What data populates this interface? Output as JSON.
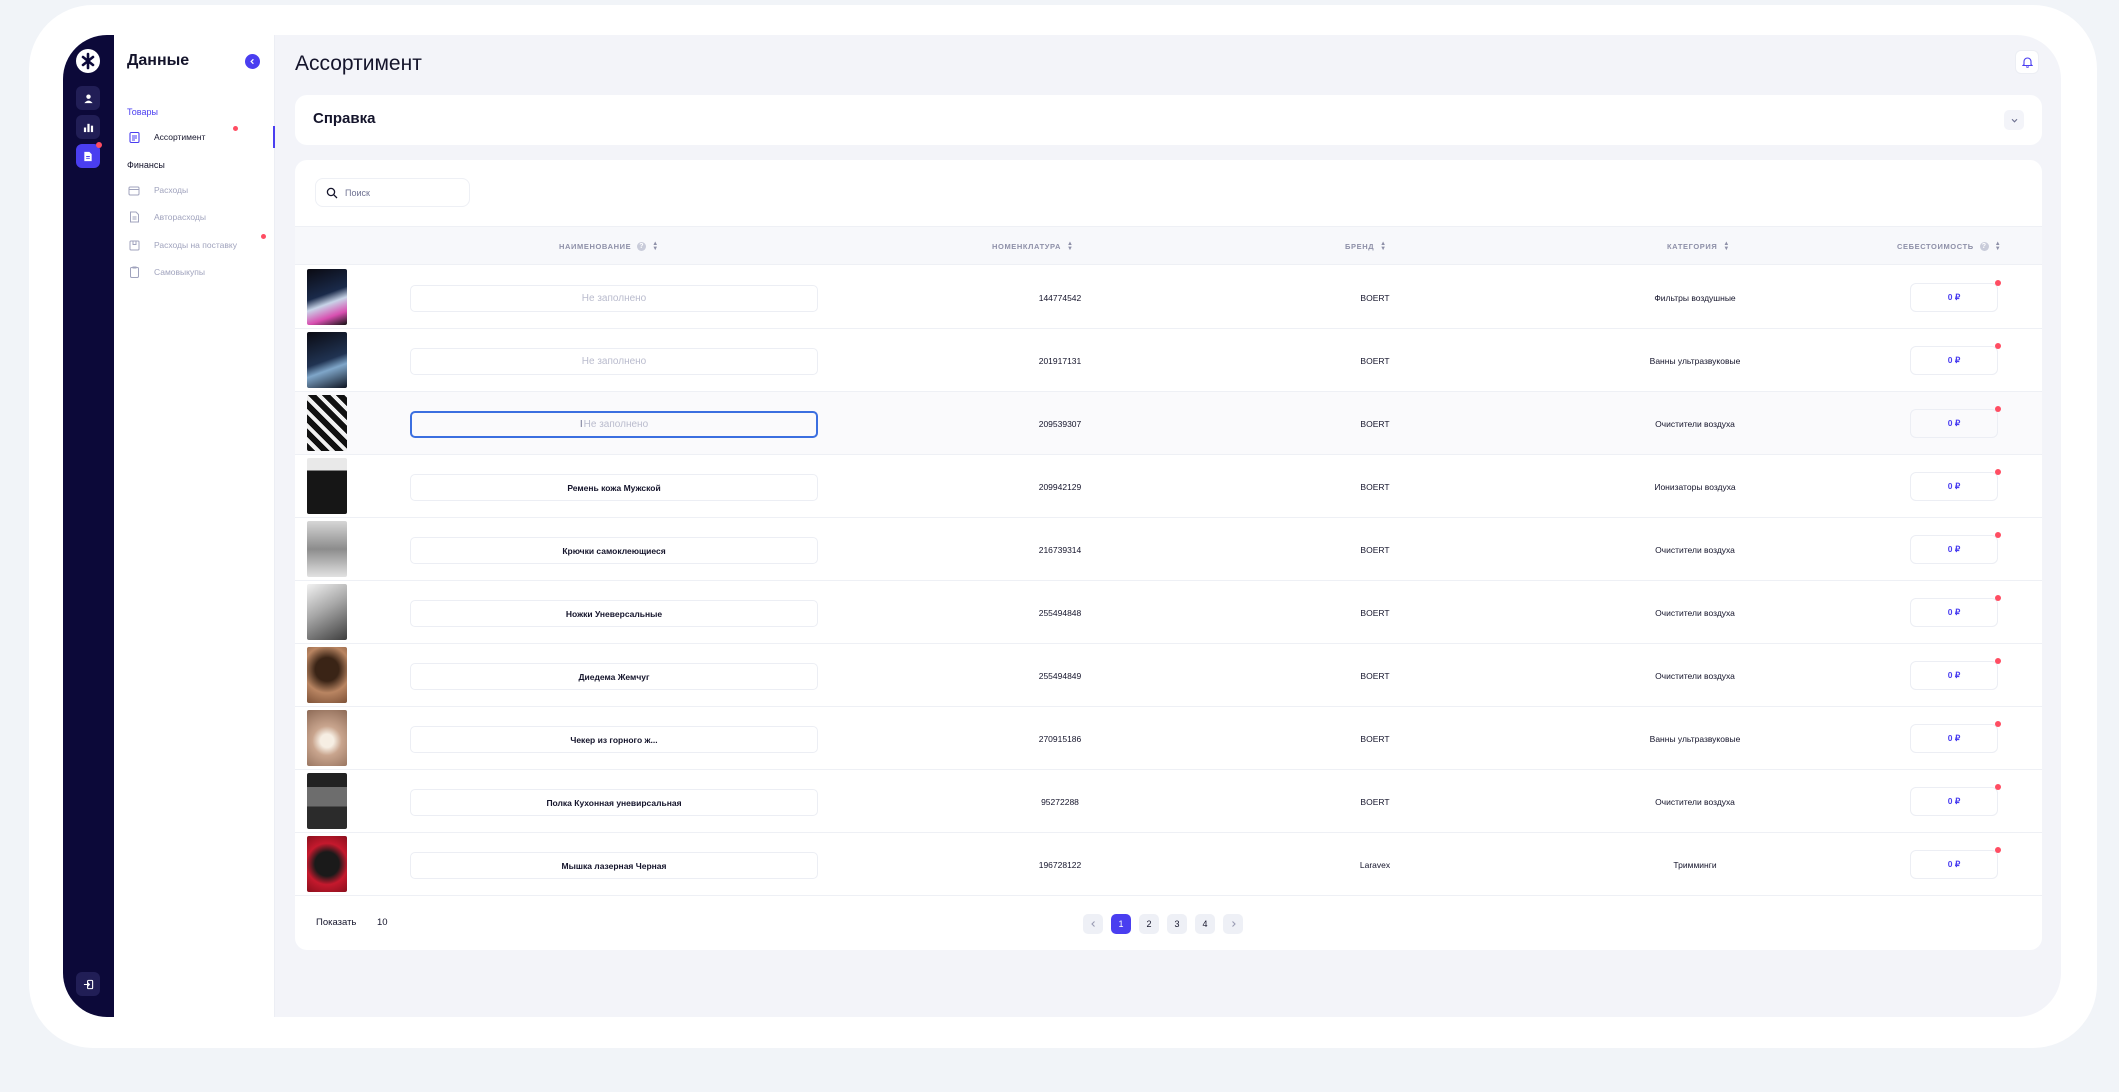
{
  "sidebar": {
    "title": "Данные",
    "sections": [
      {
        "label": "Товары",
        "items": [
          {
            "label": "Ассортимент",
            "active": true,
            "badge": true
          }
        ]
      },
      {
        "label": "Финансы",
        "items": [
          {
            "label": "Расходы",
            "active": false,
            "badge": false
          },
          {
            "label": "Авторасходы",
            "active": false,
            "badge": false
          },
          {
            "label": "Расходы на поставку",
            "active": false,
            "badge": true
          },
          {
            "label": "Самовыкупы",
            "active": false,
            "badge": false
          }
        ]
      }
    ]
  },
  "rail": {
    "icons": [
      "user-icon",
      "chart-icon",
      "document-icon"
    ],
    "active": "document-icon"
  },
  "header": {
    "title": "Ассортимент"
  },
  "help": {
    "title": "Справка"
  },
  "search": {
    "placeholder": "Поиск"
  },
  "table": {
    "columns": {
      "name": "НАИМЕНОВАНИЕ",
      "sku": "НОМЕНКЛАТУРА",
      "brand": "БРЕНД",
      "category": "КАТЕГОРИЯ",
      "cost": "СЕБЕСТОИМОСТЬ"
    },
    "empty_placeholder": "Не заполнено",
    "rows": [
      {
        "name": "",
        "sku": "144774542",
        "brand": "BOERT",
        "category": "Фильтры воздушные",
        "cost": "0 ₽"
      },
      {
        "name": "",
        "sku": "201917131",
        "brand": "BOERT",
        "category": "Ванны ультразвуковые",
        "cost": "0 ₽"
      },
      {
        "name": "",
        "sku": "209539307",
        "brand": "BOERT",
        "category": "Очистители воздуха",
        "cost": "0 ₽"
      },
      {
        "name": "Ремень кожа Мужской",
        "sku": "209942129",
        "brand": "BOERT",
        "category": "Ионизаторы воздуха",
        "cost": "0 ₽"
      },
      {
        "name": "Крючки самоклеющиеся",
        "sku": "216739314",
        "brand": "BOERT",
        "category": "Очистители воздуха",
        "cost": "0 ₽"
      },
      {
        "name": "Ножки Уневерсальные",
        "sku": "255494848",
        "brand": "BOERT",
        "category": "Очистители воздуха",
        "cost": "0 ₽"
      },
      {
        "name": "Диедема Жемчуг",
        "sku": "255494849",
        "brand": "BOERT",
        "category": "Очистители воздуха",
        "cost": "0 ₽"
      },
      {
        "name": "Чекер из горного ж...",
        "sku": "270915186",
        "brand": "BOERT",
        "category": "Ванны ультразвуковые",
        "cost": "0 ₽"
      },
      {
        "name": "Полка Кухонная уневирсальная",
        "sku": "95272288",
        "brand": "BOERT",
        "category": "Очистители воздуха",
        "cost": "0 ₽"
      },
      {
        "name": "Мышка лазерная Черная",
        "sku": "196728122",
        "brand": "Laravex",
        "category": "Тримминги",
        "cost": "0 ₽"
      }
    ]
  },
  "pagination": {
    "show_label": "Показать",
    "page_size": "10",
    "pages": [
      "1",
      "2",
      "3",
      "4"
    ],
    "current": "1"
  },
  "colors": {
    "accent": "#4a3ef0",
    "rail": "#0c0939",
    "badge": "#ff4d62"
  }
}
